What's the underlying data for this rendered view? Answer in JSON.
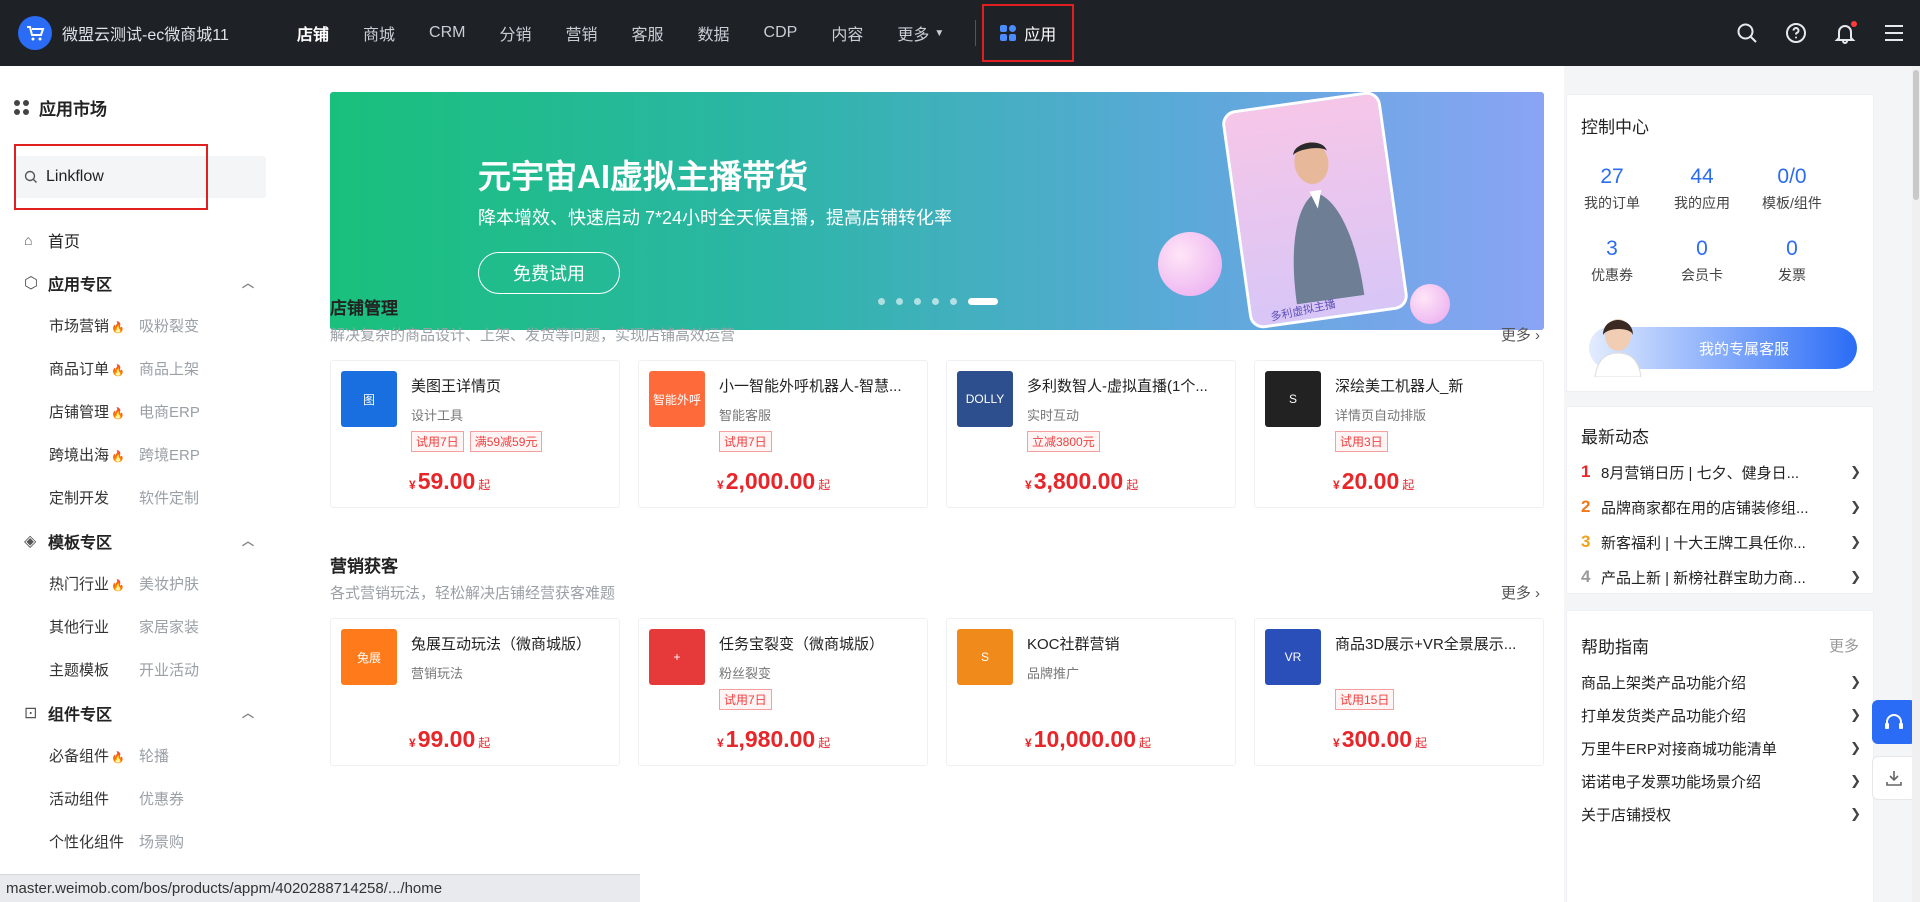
{
  "header": {
    "app_title": "微盟云测试-ec微商城11",
    "nav": [
      "店铺",
      "商城",
      "CRM",
      "分销",
      "营销",
      "客服",
      "数据",
      "CDP",
      "内容"
    ],
    "more_label": "更多",
    "app_label": "应用"
  },
  "sidebar": {
    "title": "应用市场",
    "search_value": "Linkflow",
    "home_label": "首页",
    "sections": [
      {
        "label": "应用专区",
        "items": [
          {
            "main": "市场营销",
            "second": "吸粉裂变",
            "hot": true
          },
          {
            "main": "商品订单",
            "second": "商品上架",
            "hot": true
          },
          {
            "main": "店铺管理",
            "second": "电商ERP",
            "hot": true
          },
          {
            "main": "跨境出海",
            "second": "跨境ERP",
            "hot": true
          },
          {
            "main": "定制开发",
            "second": "软件定制",
            "hot": false
          }
        ]
      },
      {
        "label": "模板专区",
        "items": [
          {
            "main": "热门行业",
            "second": "美妆护肤",
            "hot": true
          },
          {
            "main": "其他行业",
            "second": "家居家装",
            "hot": false
          },
          {
            "main": "主题模板",
            "second": "开业活动",
            "hot": false
          }
        ]
      },
      {
        "label": "组件专区",
        "items": [
          {
            "main": "必备组件",
            "second": "轮播",
            "hot": true
          },
          {
            "main": "活动组件",
            "second": "优惠券",
            "hot": false
          },
          {
            "main": "个性化组件",
            "second": "场景购",
            "hot": false
          }
        ]
      }
    ]
  },
  "banner": {
    "headline": "元宇宙AI虚拟主播带货",
    "subline": "降本增效、快速启动  7*24小时全天候直播，提高店铺转化率",
    "cta": "免费试用",
    "caption": "多利虚拟主播",
    "slide_count": 6,
    "active_slide": 6
  },
  "store_section": {
    "title": "店铺管理",
    "desc": "解决复杂的商品设计、上架、发货等问题，实现店铺高效运营",
    "more": "更多",
    "cards": [
      {
        "name": "美图王详情页",
        "cat": "设计工具",
        "tags": [
          "试用7日",
          "满59减59元"
        ],
        "price": "59.00",
        "thumb_text": "图",
        "thumb_color": "#1a6fe0"
      },
      {
        "name": "小一智能外呼机器人-智慧...",
        "cat": "智能客服",
        "tags": [
          "试用7日"
        ],
        "price": "2,000.00",
        "thumb_text": "智能外呼",
        "thumb_color": "#ff6a3a"
      },
      {
        "name": "多利数智人-虚拟直播(1个...",
        "cat": "实时互动",
        "tags": [
          "立减3800元"
        ],
        "price": "3,800.00",
        "thumb_text": "DOLLY",
        "thumb_color": "#2d4f8e"
      },
      {
        "name": "深绘美工机器人_新",
        "cat": "详情页自动排版",
        "tags": [
          "试用3日"
        ],
        "price": "20.00",
        "thumb_text": "S",
        "thumb_color": "#222222"
      }
    ]
  },
  "marketing_section": {
    "title": "营销获客",
    "desc": "各式营销玩法，轻松解决店铺经营获客难题",
    "more": "更多",
    "cards": [
      {
        "name": "兔展互动玩法（微商城版）",
        "cat": "营销玩法",
        "tags": [],
        "price": "99.00",
        "thumb_text": "兔展",
        "thumb_color": "#ff7a1a"
      },
      {
        "name": "任务宝裂变（微商城版）",
        "cat": "粉丝裂变",
        "tags": [
          "试用7日"
        ],
        "price": "1,980.00",
        "thumb_text": "+",
        "thumb_color": "#e63a3a"
      },
      {
        "name": "KOC社群营销",
        "cat": "品牌推广",
        "tags": [],
        "price": "10,000.00",
        "thumb_text": "S",
        "thumb_color": "#f08a1a"
      },
      {
        "name": "商品3D展示+VR全景展示...",
        "cat": "",
        "tags": [
          "试用15日"
        ],
        "price": "300.00",
        "thumb_text": "VR",
        "thumb_color": "#2a4fb8"
      }
    ]
  },
  "price_symbol": "¥",
  "price_suffix": "起",
  "control_center": {
    "title": "控制中心",
    "stats": [
      {
        "n": "27",
        "l": "我的订单"
      },
      {
        "n": "44",
        "l": "我的应用"
      },
      {
        "n": "0/0",
        "l": "模板/组件"
      },
      {
        "n": "3",
        "l": "优惠券"
      },
      {
        "n": "0",
        "l": "会员卡"
      },
      {
        "n": "0",
        "l": "发票"
      }
    ],
    "cs_label": "我的专属客服"
  },
  "news": {
    "title": "最新动态",
    "items": [
      {
        "num": "1",
        "text": "8月营销日历 | 七夕、健身日...",
        "color": "#e8262a"
      },
      {
        "num": "2",
        "text": "品牌商家都在用的店铺装修组...",
        "color": "#f07a1a"
      },
      {
        "num": "3",
        "text": "新客福利 | 十大王牌工具任你...",
        "color": "#f0a01a"
      },
      {
        "num": "4",
        "text": "产品上新 | 新榜社群宝助力商...",
        "color": "#999999"
      }
    ]
  },
  "help": {
    "title": "帮助指南",
    "more": "更多",
    "items": [
      "商品上架类产品功能介绍",
      "打单发货类产品功能介绍",
      "万里牛ERP对接商城功能清单",
      "诺诺电子发票功能场景介绍",
      "关于店铺授权"
    ]
  },
  "status_url": "master.weimob.com/bos/products/appm/4020288714258/.../home"
}
